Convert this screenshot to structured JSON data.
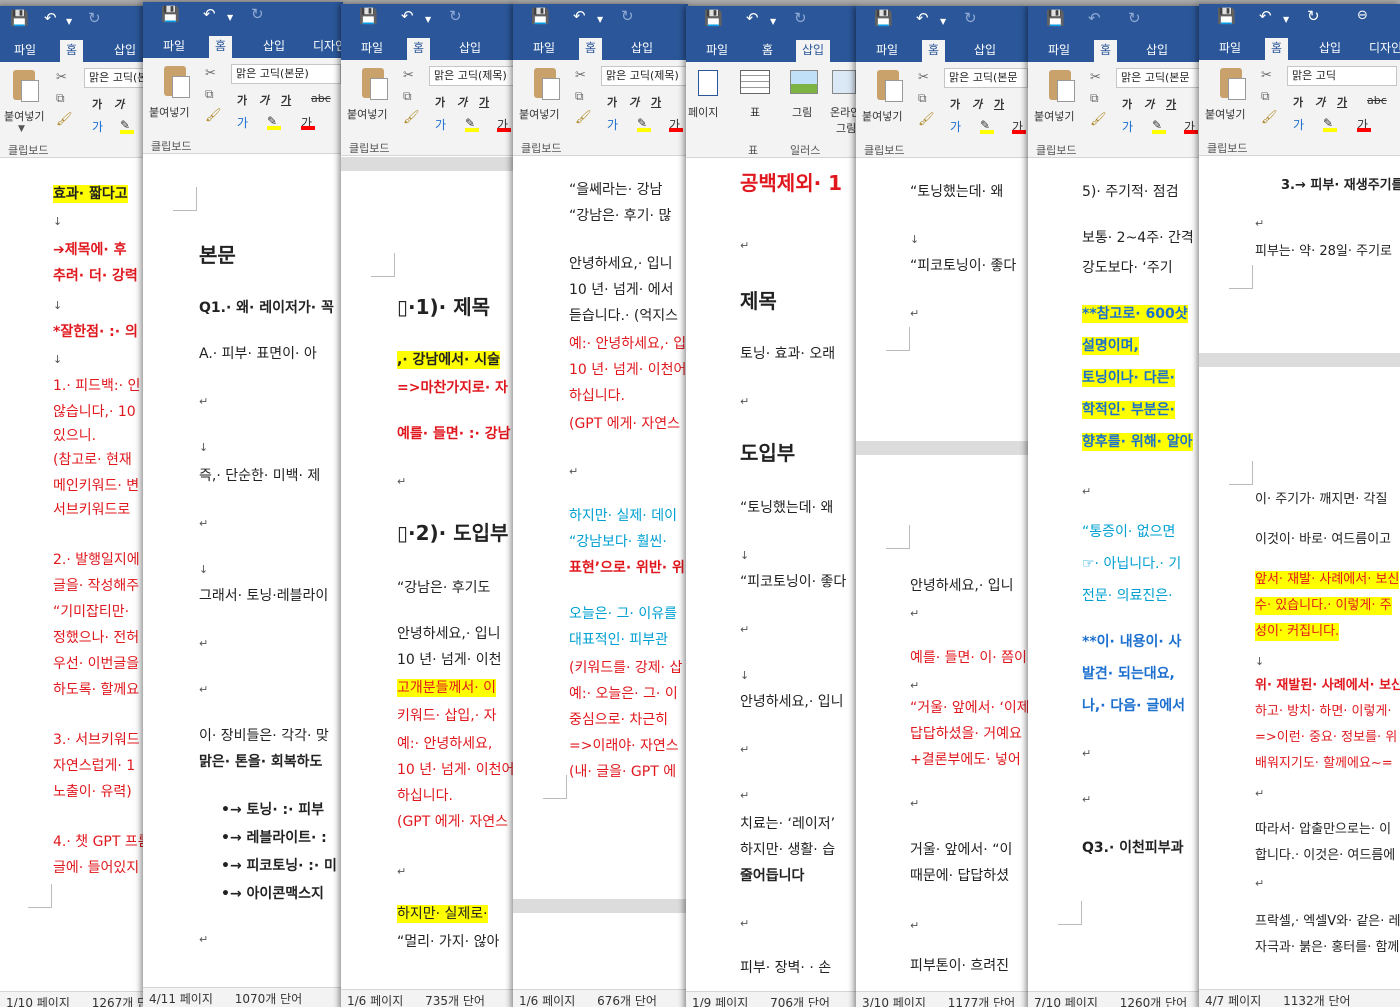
{
  "ribbon": {
    "tab_file": "파일",
    "tab_home": "홈",
    "tab_insert": "삽입",
    "tab_design": "디자인",
    "paste_label": "붙여넣기",
    "clipboard_group": "클립보드",
    "page_label": "페이지",
    "table_label": "표",
    "picture_label": "그림",
    "online_label": "온라인",
    "online_label2": "그림",
    "illustration_group": "일러스",
    "fmt_bold": "가",
    "fmt_italic": "가",
    "fmt_underline": "가",
    "fmt_strike": "abc",
    "fmt_font_color": "가"
  },
  "windows": [
    {
      "font": "맑은 고딕(본문)",
      "status_page": "1/10 페이지",
      "status_words": "1267개 단어",
      "lines": [
        "효과· 짧다고",
        "➔제목에· 후",
        "추려· 더· 강력",
        "*잘한점· :· 의",
        "1.· 피드백:· 인",
        "않습니다,· 10",
        "있으니.",
        "(참고로· 현재",
        "메인키워드· 변",
        "서브키워드로",
        "2.· 발행일지에",
        "글을· 작성해주",
        "“기미잡티만·",
        "정했으나· 전허",
        "우선· 이번글을",
        "하도록· 할께요",
        "3.· 서브키워드",
        "자연스럽게· 1",
        "노출이· 유력)",
        "4.· 챗 GPT 프롬",
        "글에· 들어있지"
      ]
    },
    {
      "font": "맑은 고딕(본문)",
      "status_page": "4/11 페이지",
      "status_words": "1070개 단어",
      "lines": [
        "본문",
        "Q1.· 왜· 레이저가· 꼭",
        "A.·  피부· 표면이· 아",
        "즉,· 단순한· 미백· 제",
        "그래서· 토닝·레블라이",
        "이· 장비들은· 각각· 맞",
        "맑은· 톤을· 회복하도",
        "•→ 토닝· :· 피부",
        "•→ 레블라이트· :",
        "•→ 피코토닝· :· 미",
        "•→ 아이콘맥스지"
      ]
    },
    {
      "font": "맑은 고딕(제목)",
      "status_page": "1/6 페이지",
      "status_words": "735개 단어",
      "lines": [
        "▯·1)· 제목",
        ",· 강남에서· 시술",
        "=>마찬가지로· 자",
        "예를· 들면· :· 강남",
        "▯·2)· 도입부",
        "“강남은· 후기도",
        "안녕하세요,· 입니",
        "10 년· 넘게· 이천",
        "고개분들께서· 이",
        "키워드· 삽입,· 자",
        "예:· 안녕하세요,",
        "10 년· 넘게· 이천어",
        "하십니다.",
        "(GPT 에게· 자연스",
        "하지만· 실제로·",
        "“멀리· 가지· 않아"
      ]
    },
    {
      "font": "맑은 고딕(제목)",
      "status_page": "1/6 페이지",
      "status_words": "676개 단어",
      "lines": [
        "“을쎄라는· 강남",
        "“강남은· 후기· 많",
        "안녕하세요,· 입니",
        "10 년· 넘게· 에서",
        "듣습니다.· (억지스",
        "예:· 안녕하세요,· 입",
        "10 년· 넘게· 이천어",
        "하십니다.",
        "(GPT 에게· 자연스",
        "하지만· 실제· 데이",
        "“강남보다· 훨씬·",
        "표현’으로· 위반· 위",
        "오늘은· 그· 이유를",
        "대표적인· 피부관",
        "(키워드를· 강제· 삽",
        "예:· 오늘은· 그· 이",
        "중심으로· 차근히",
        "=>이래야· 자연스",
        "(내· 글을· GPT 에"
      ]
    },
    {
      "status_page": "1/9 페이지",
      "status_words": "706개 단어",
      "lines": [
        "공백제외· 1",
        "제목",
        "토닝· 효과· 오래",
        "도입부",
        "“토닝했는데· 왜",
        "“피코토닝이· 좋다",
        "안녕하세요,· 입니",
        "치료는· ‘레이저’",
        "하지만· 생활· 습",
        "줄어듭니다",
        "피부· 장벽· · 손"
      ]
    },
    {
      "font": "맑은 고딕(본문",
      "status_page": "3/10 페이지",
      "status_words": "1177개 단어",
      "lines": [
        "“토닝했는데· 왜",
        "“피코토닝이· 좋다",
        "안녕하세요,· 입니",
        "예를· 들면· 이· 쯤이",
        "“거울· 앞에서· ‘이제",
        "답답하셨을· 거예요",
        "+결론부에도· 넣어",
        "거울· 앞에서· “이",
        "때문에· 답답하셨",
        "피부톤이· 흐려진"
      ]
    },
    {
      "font": "맑은 고딕(본문",
      "status_page": "7/10 페이지",
      "status_words": "1260개 단어",
      "lines": [
        "5)· 주기적· 점검",
        "보통· 2~4주· 간격",
        "강도보다· ‘주기",
        "**참고로· 600샷",
        "설명이며,",
        "토닝이나· 다른·",
        "학적인· 부분은·",
        "향후를· 위해· 알아",
        "“통증이· 없으면",
        "☞· 아닙니다.· 기",
        "전문· 의료진은·",
        "**이· 내용이· 사",
        "발견· 되는대요,",
        "나,· 다음· 글에서",
        "Q3.· 이천피부과"
      ]
    },
    {
      "font": "맑은 고딕",
      "status_page": "4/7 페이지",
      "status_words": "1132개 단어",
      "lines": [
        "3.→ 피부· 재생주기를",
        "피부는· 약· 28일· 주기로",
        "이· 주기가· 깨지면· 각질",
        "이것이· 바로· 여드름이고",
        "앞서· 재발· 사례에서· 보신",
        "수· 있습니다.· 이렇게· 주",
        "성이· 커집니다.",
        "위· 재발된· 사례에서· 보신",
        "하고· 방치· 하면· 이렇게·",
        "=>이런· 중요· 정보를· 위",
        "배워지기도· 할께에요~=",
        "따라서· 압출만으로는· 이",
        "합니다.· 이것은· 여드름에",
        "프락셀,· 엑셀V와· 같은· 레",
        "자극과· 붉은· 홍터를· 함께"
      ]
    }
  ]
}
